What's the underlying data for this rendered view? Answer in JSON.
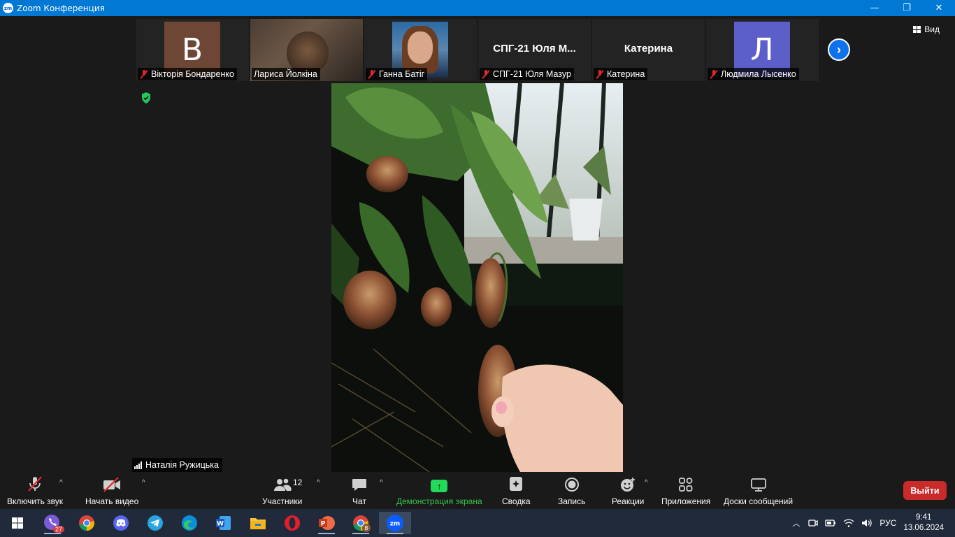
{
  "window": {
    "title": "Zoom Конференция",
    "app_badge": "zm",
    "minimize": "—",
    "maximize": "❐",
    "close": "✕"
  },
  "participants_strip": [
    {
      "type": "avatar",
      "initial": "B",
      "color": "#6e4636",
      "label": "Вікторія Бондаренко",
      "muted": true
    },
    {
      "type": "photo",
      "label": "Лариса Йолкіна",
      "muted": false
    },
    {
      "type": "photo2",
      "label": "Ганна Батіг",
      "muted": true
    },
    {
      "type": "name",
      "bigname": "СПГ-21 Юля М...",
      "label": "СПГ-21 Юля Мазур",
      "muted": true
    },
    {
      "type": "name",
      "bigname": "Катерина",
      "label": "Катерина",
      "muted": true
    },
    {
      "type": "avatar",
      "initial": "Л",
      "color": "#5c5ec9",
      "label": "Людмила Лысенко",
      "muted": true
    }
  ],
  "view_button": {
    "label": "Вид"
  },
  "next_button": {
    "glyph": "›"
  },
  "active_speaker": {
    "name": "Наталія Ружицька"
  },
  "toolbar": {
    "audio": {
      "label": "Включить звук"
    },
    "video": {
      "label": "Начать видео"
    },
    "participants": {
      "label": "Участники",
      "count": "12"
    },
    "chat": {
      "label": "Чат"
    },
    "share": {
      "label": "Демонстрация экрана",
      "color": "#23d959"
    },
    "summary": {
      "label": "Сводка"
    },
    "record": {
      "label": "Запись"
    },
    "reactions": {
      "label": "Реакции"
    },
    "apps": {
      "label": "Приложения"
    },
    "boards": {
      "label": "Доски сообщений"
    },
    "leave": {
      "label": "Выйти",
      "color": "#c92a2a"
    }
  },
  "taskbar": {
    "apps": [
      "windows-start",
      "viber",
      "chrome",
      "discord",
      "telegram",
      "edge",
      "word",
      "file-explorer",
      "opera",
      "powerpoint",
      "chrome-profile",
      "zoom"
    ],
    "viber_badge": "27",
    "chrome_profile_badge": "B",
    "language": "РУС",
    "time": "9:41",
    "date": "13.06.2024"
  }
}
